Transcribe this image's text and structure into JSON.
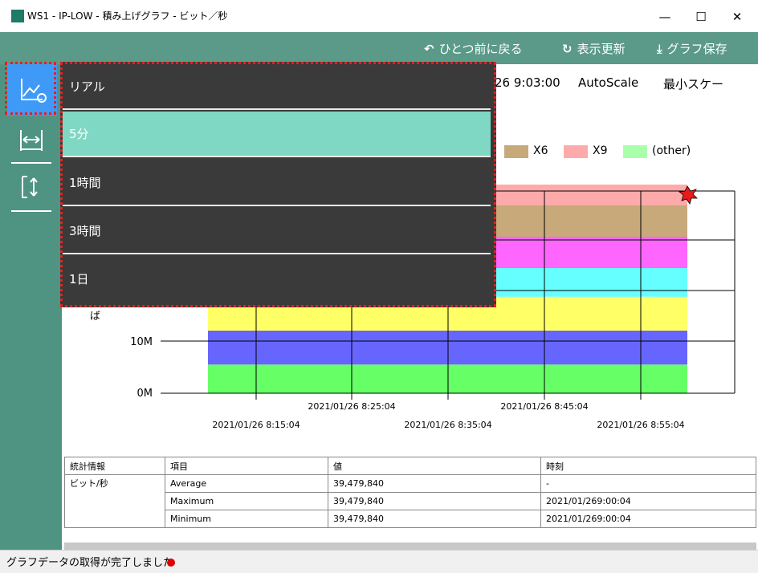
{
  "window": {
    "title": "WS1 - IP-LOW - 積み上げグラフ - ビット／秒",
    "minimize": "—",
    "maximize": "☐",
    "close": "✕"
  },
  "toolbar": {
    "back_label": "ひとつ前に戻る",
    "refresh_label": "表示更新",
    "save_label": "グラフ保存"
  },
  "header": {
    "timestamp": "26 9:03:00",
    "autoscale": "AutoScale",
    "min_scale": "最小スケー"
  },
  "dropdown": {
    "items": [
      "リアル",
      "5分",
      "1時間",
      "3時間",
      "1日"
    ],
    "selected_index": 1
  },
  "legend": [
    {
      "name": "X6",
      "color": "#c8a97a"
    },
    {
      "name": "X9",
      "color": "#ffaaaa"
    },
    {
      "name": "(other)",
      "color": "#aaffaa"
    }
  ],
  "chart_data": {
    "type": "area",
    "stacked": true,
    "ylabel_partial": "ば",
    "y_ticks": [
      "0M",
      "10M"
    ],
    "x_tick_labels_upper": [
      "2021/01/26 8:25:04",
      "2021/01/26 8:45:04"
    ],
    "x_tick_labels_lower": [
      "2021/01/26 8:15:04",
      "2021/01/26 8:35:04",
      "2021/01/26 8:55:04"
    ],
    "series_colors": [
      "#66ff66",
      "#6666ff",
      "#ffff66",
      "#66ffff",
      "#ff66ff",
      "#c8a97a",
      "#ffaaaa"
    ],
    "band_heights": [
      5.5,
      6.5,
      6.5,
      5.5,
      6,
      6,
      7
    ]
  },
  "stats": {
    "headers": [
      "統計情報",
      "項目",
      "値",
      "時刻"
    ],
    "group_label": "ビット/秒",
    "rows": [
      {
        "item": "Average",
        "value": "39,479,840",
        "time": "-"
      },
      {
        "item": "Maximum",
        "value": "39,479,840",
        "time": "2021/01/269:00:04"
      },
      {
        "item": "Minimum",
        "value": "39,479,840",
        "time": "2021/01/269:00:04"
      }
    ]
  },
  "status": {
    "message": "グラフデータの取得が完了しました"
  }
}
